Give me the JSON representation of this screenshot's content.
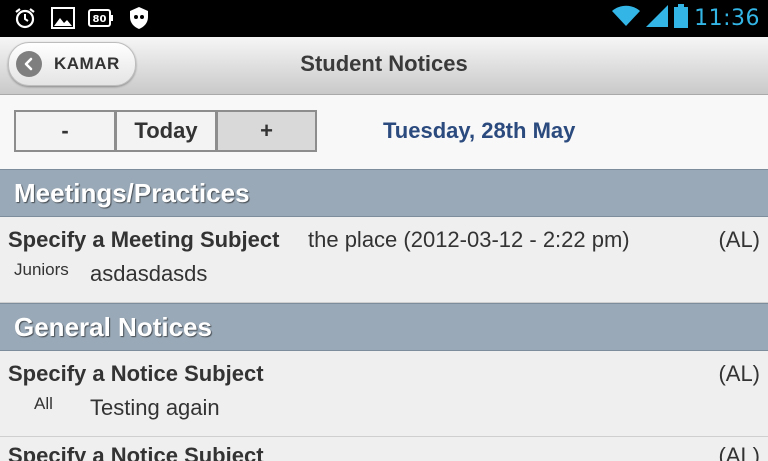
{
  "status_bar": {
    "time": "11:36",
    "icons": [
      "alarm-icon",
      "image-icon",
      "battery-saver-icon",
      "shield-icon",
      "wifi-icon",
      "signal-icon",
      "battery-icon"
    ]
  },
  "action_bar": {
    "back_label": "KAMAR",
    "title": "Student Notices"
  },
  "date_nav": {
    "prev_label": "-",
    "today_label": "Today",
    "next_label": "+",
    "current_date": "Tuesday, 28th May"
  },
  "sections": [
    {
      "title": "Meetings/Practices",
      "items": [
        {
          "subject": "Specify a Meeting Subject",
          "place": "the place (2012-03-12 - 2:22 pm)",
          "code": "(AL)",
          "group": "Juniors",
          "body": "asdasdasds"
        }
      ]
    },
    {
      "title": "General Notices",
      "items": [
        {
          "subject": "Specify a Notice Subject",
          "code": "(AL)",
          "group": "All",
          "body": "Testing again"
        },
        {
          "subject": "Specify a Notice Subject",
          "code": "(AL)"
        }
      ]
    }
  ],
  "colors": {
    "status_bar_bg": "#000000",
    "clock": "#33b5e5",
    "date_label": "#2b4a7e",
    "section_header_bg": "#9aa9b7"
  }
}
